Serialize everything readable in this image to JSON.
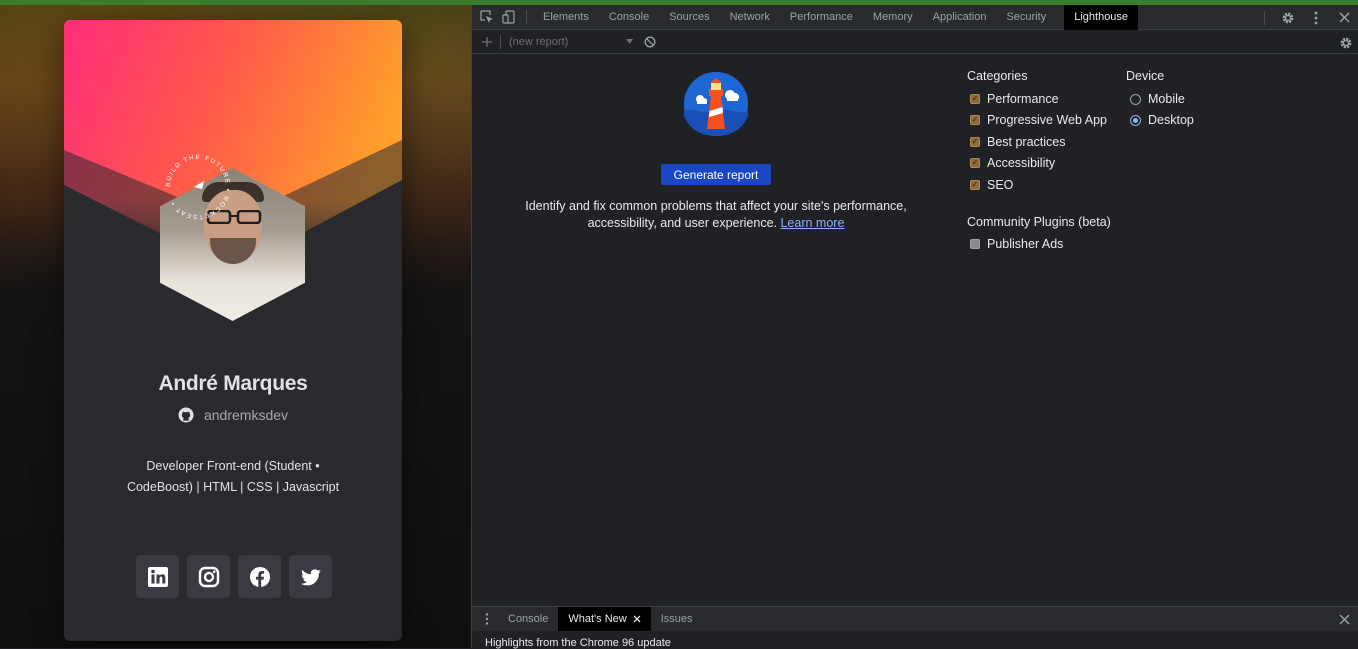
{
  "card": {
    "name": "André Marques",
    "github_handle": "andremksdev",
    "bio_line1": "Developer Front-end (Student •",
    "bio_line2": "CodeBoost) | HTML | CSS | Javascript",
    "badge_text": "BUILD THE FUTURE • ROCKETSEAT •",
    "socials": [
      "linkedin-icon",
      "instagram-icon",
      "facebook-icon",
      "twitter-icon"
    ],
    "colors": {
      "card_bg": "#29292e",
      "social_bg": "#3a3a42",
      "cover_pink": "#ff2d7a",
      "cover_orange": "#ffa02a"
    }
  },
  "devtools": {
    "tabs": [
      "Elements",
      "Console",
      "Sources",
      "Network",
      "Performance",
      "Memory",
      "Application",
      "Security",
      "Lighthouse"
    ],
    "active_tab": "Lighthouse",
    "report_select": "(new report)",
    "lighthouse": {
      "generate_button": "Generate report",
      "description": "Identify and fix common problems that affect your site's performance, accessibility, and user experience.",
      "learn_more": "Learn more",
      "categories_title": "Categories",
      "categories": [
        {
          "label": "Performance",
          "checked": true
        },
        {
          "label": "Progressive Web App",
          "checked": true
        },
        {
          "label": "Best practices",
          "checked": true
        },
        {
          "label": "Accessibility",
          "checked": true
        },
        {
          "label": "SEO",
          "checked": true
        }
      ],
      "plugins_title": "Community Plugins (beta)",
      "plugins": [
        {
          "label": "Publisher Ads",
          "checked": false
        }
      ],
      "device_title": "Device",
      "devices": [
        {
          "label": "Mobile",
          "selected": false
        },
        {
          "label": "Desktop",
          "selected": true
        }
      ]
    },
    "drawer": {
      "tabs": [
        "Console",
        "What's New",
        "Issues"
      ],
      "active_tab": "What's New",
      "content": "Highlights from the Chrome 96 update"
    },
    "colors": {
      "accent_button": "#1a46c4",
      "link": "#8ab4f8",
      "panel_bg": "#202124",
      "toolbar_bg": "#292a2d"
    }
  }
}
